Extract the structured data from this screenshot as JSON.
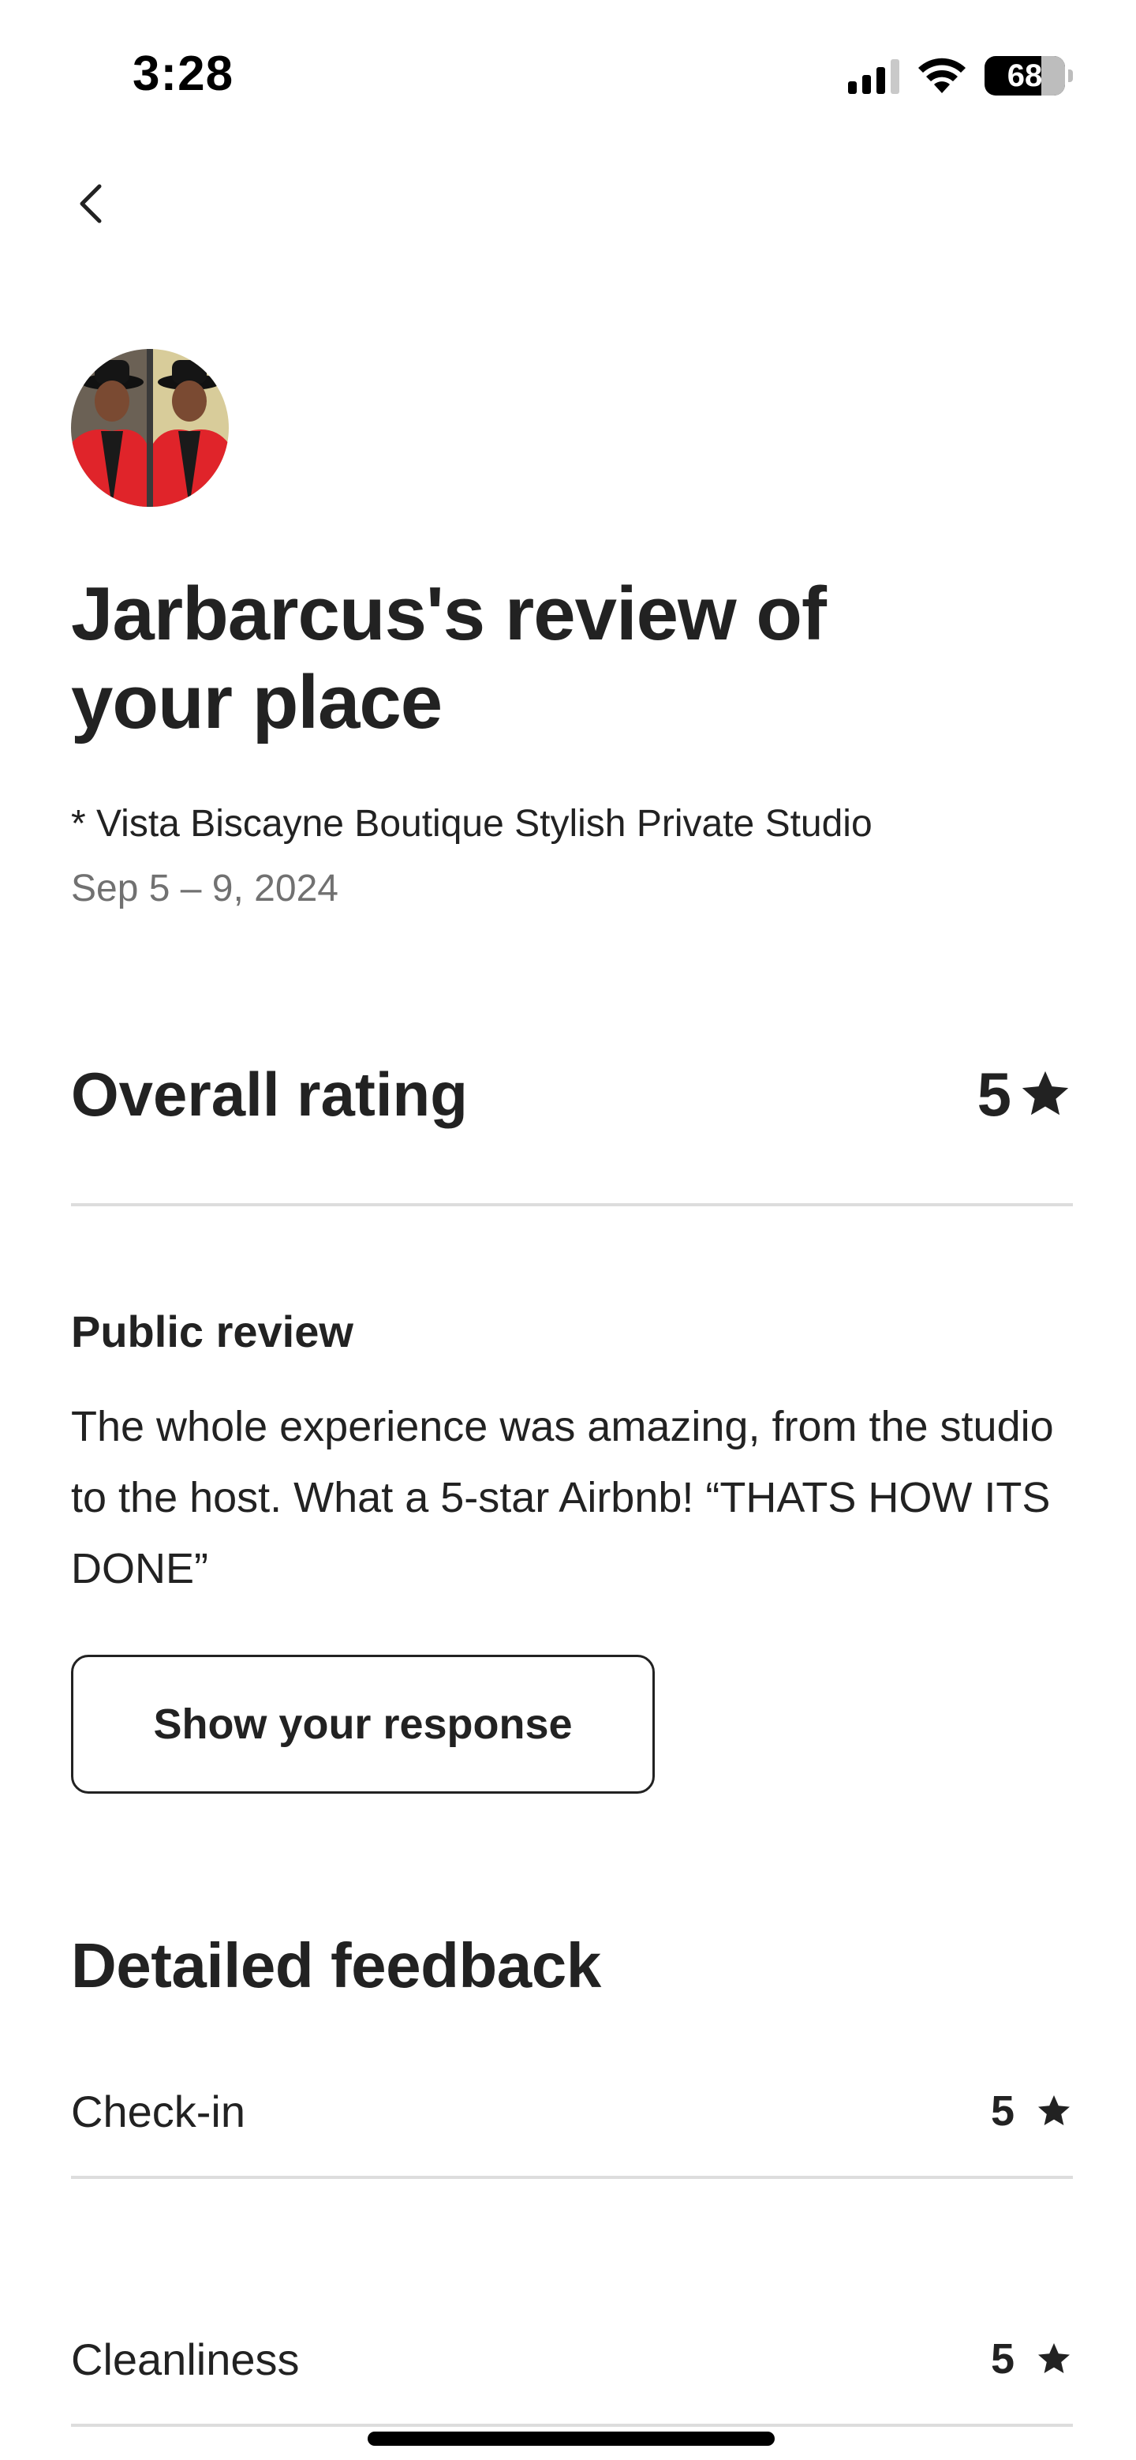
{
  "status_bar": {
    "time": "3:28",
    "battery": "68"
  },
  "header": {
    "back_icon": "chevron-left-icon"
  },
  "review": {
    "title": "Jarbarcus's review of your place",
    "listing": "* Vista Biscayne Boutique Stylish Private Studio",
    "dates": "Sep 5 – 9, 2024",
    "overall_label": "Overall rating",
    "overall_value": "5",
    "public_label": "Public review",
    "public_text": "The whole experience was amazing, from the studio to the host. What a 5-star Airbnb! “THATS HOW ITS DONE”",
    "response_button": "Show your response"
  },
  "feedback": {
    "heading": "Detailed feedback",
    "items": [
      {
        "label": "Check-in",
        "value": "5"
      },
      {
        "label": "Cleanliness",
        "value": "5"
      }
    ]
  },
  "colors": {
    "text": "#222222",
    "muted": "#717171",
    "divider": "#dddddd"
  }
}
